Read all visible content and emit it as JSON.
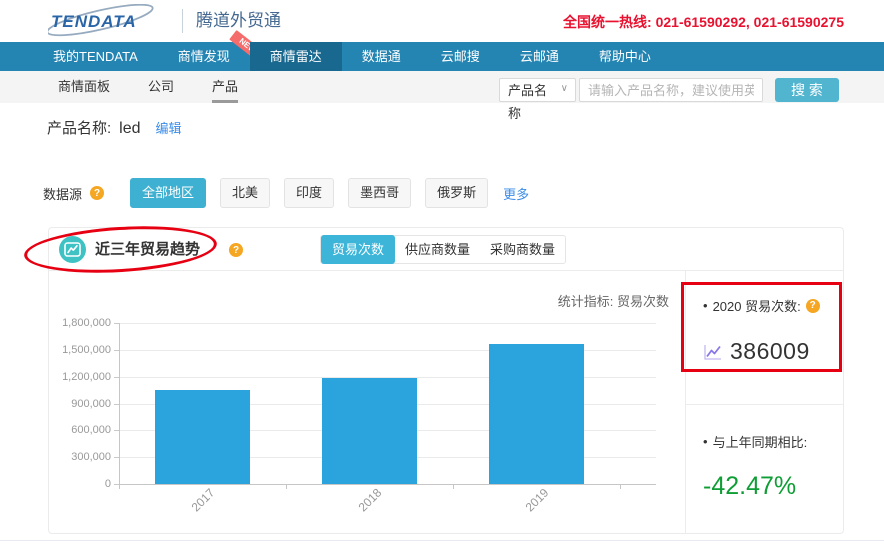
{
  "header": {
    "logo_text": "TENDATA",
    "brand_cn": "腾道外贸通",
    "hotline_label": "全国统一热线:",
    "hotline_numbers": "021-61590292, 021-61590275"
  },
  "nav": {
    "items": [
      {
        "id": "my-tendata",
        "label": "我的TENDATA",
        "active": false
      },
      {
        "id": "business-discovery",
        "label": "商情发现",
        "active": false,
        "badge": "NEW"
      },
      {
        "id": "business-radar",
        "label": "商情雷达",
        "active": true
      },
      {
        "id": "data-link",
        "label": "数据通",
        "active": false
      },
      {
        "id": "cloud-mail-search",
        "label": "云邮搜",
        "active": false
      },
      {
        "id": "cloud-mail",
        "label": "云邮通",
        "active": false
      },
      {
        "id": "help-center",
        "label": "帮助中心",
        "active": false
      }
    ]
  },
  "subnav": {
    "items": [
      {
        "id": "business-panel",
        "label": "商情面板",
        "active": false
      },
      {
        "id": "company",
        "label": "公司",
        "active": false
      },
      {
        "id": "product",
        "label": "产品",
        "active": true
      }
    ],
    "search": {
      "category_value": "产品名称",
      "placeholder": "请输入产品名称，建议使用英",
      "button_label": "搜 索",
      "caret_glyph": "∨"
    }
  },
  "product": {
    "label": "产品名称:",
    "value": "led",
    "edit_label": "编辑"
  },
  "datasource": {
    "label": "数据源",
    "regions": [
      "全部地区",
      "北美",
      "印度",
      "墨西哥",
      "俄罗斯"
    ],
    "active_index": 0,
    "more_label": "更多"
  },
  "trend_section": {
    "title": "近三年贸易趋势",
    "tabs": [
      "贸易次数",
      "供应商数量",
      "采购商数量"
    ],
    "active_tab_index": 0,
    "indicator_label": "统计指标: 贸易次数"
  },
  "chart_data": {
    "type": "bar",
    "categories": [
      "2017",
      "2018",
      "2019"
    ],
    "values": [
      1050000,
      1190000,
      1570000
    ],
    "title": "近三年贸易趋势",
    "xlabel": "",
    "ylabel": "",
    "ylim": [
      0,
      1800000
    ],
    "ytick_step": 300000,
    "grid": true,
    "legend": "none",
    "bar_color": "#2ba3dc"
  },
  "stats": {
    "label_2020": "2020 贸易次数:",
    "value_2020": "386009",
    "compare_label": "与上年同期相比:",
    "compare_value": "-42.47%"
  },
  "colors": {
    "nav_blue": "#2484b2",
    "nav_active_blue": "#18688f",
    "accent_cyan": "#3eb1d3",
    "bar_blue": "#2ba3dc",
    "annotation_red": "#e60012",
    "hotline_red": "#e8112f",
    "link_blue": "#3a8ce8",
    "negative_green": "#0f9d35",
    "help_orange": "#f5a623",
    "trend_icon_teal": "#3ec2c4",
    "stat_icon_purple": "#8a77e8"
  }
}
